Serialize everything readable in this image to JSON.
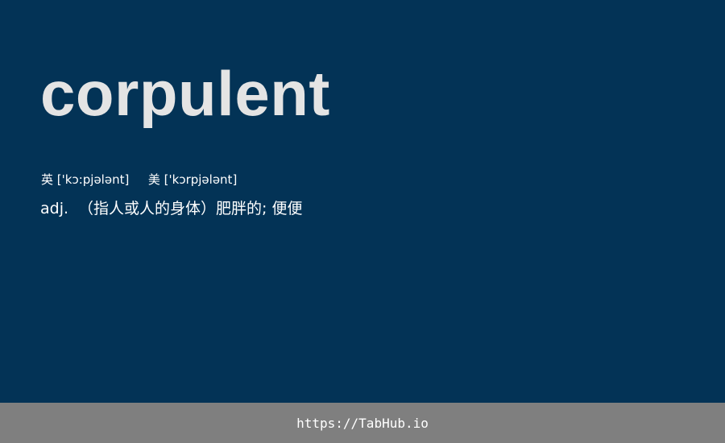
{
  "entry": {
    "word": "corpulent",
    "phonetics": {
      "uk_label": "英",
      "uk_ipa": "['kɔ:pjələnt]",
      "us_label": "美",
      "us_ipa": "['kɔrpjələnt]"
    },
    "definition": {
      "pos": "adj.",
      "meaning": "（指人或人的身体）肥胖的; 便便"
    }
  },
  "footer": {
    "link_text": "https://TabHub.io"
  },
  "colors": {
    "background": "#033356",
    "word": "#e4e4e4",
    "text": "#ffffff",
    "footer_bar": "#7f7f7f"
  }
}
